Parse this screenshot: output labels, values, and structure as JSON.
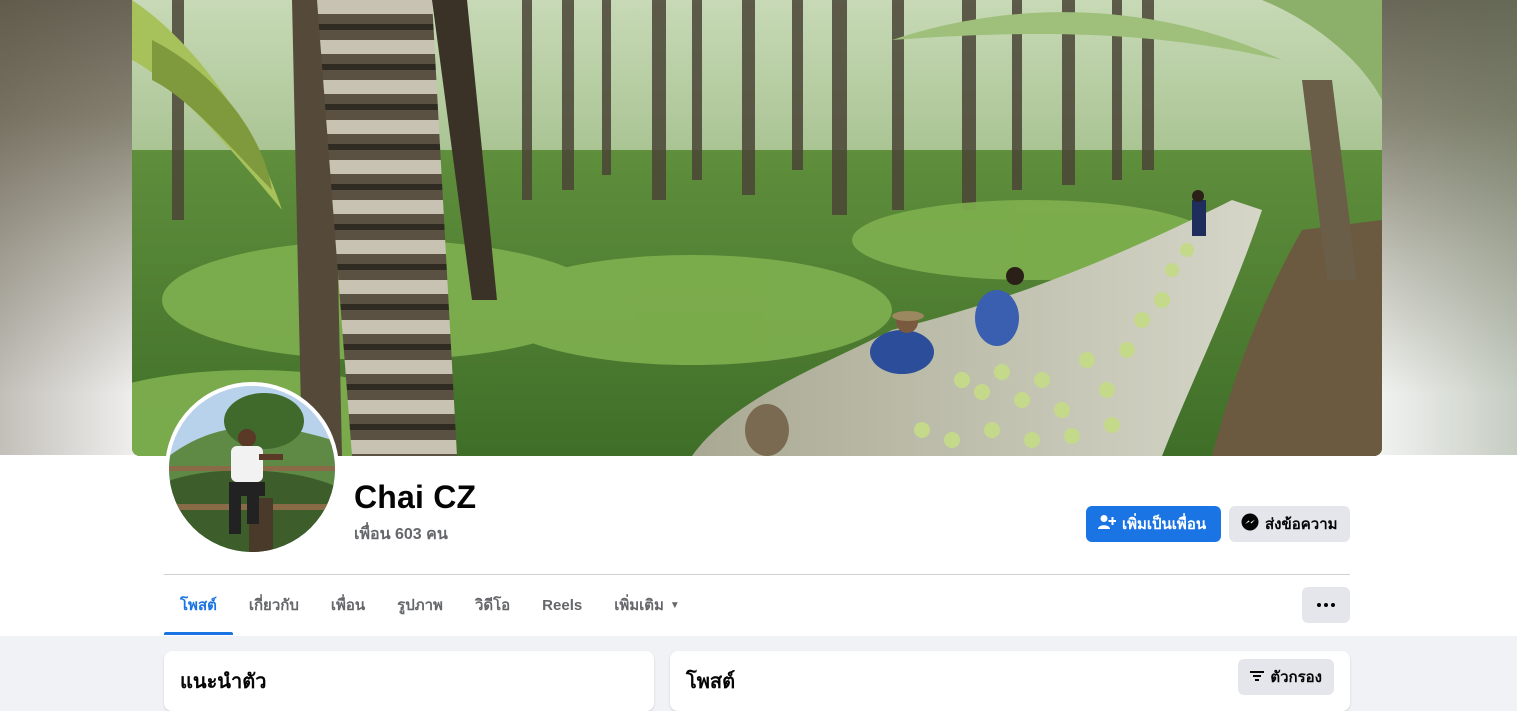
{
  "profile": {
    "name": "Chai CZ",
    "friends_text": "เพื่อน 603 คน"
  },
  "actions": {
    "add_friend": "เพิ่มเป็นเพื่อน",
    "message": "ส่งข้อความ"
  },
  "tabs": [
    {
      "label": "โพสต์",
      "active": true
    },
    {
      "label": "เกี่ยวกับ"
    },
    {
      "label": "เพื่อน"
    },
    {
      "label": "รูปภาพ"
    },
    {
      "label": "วิดีโอ"
    },
    {
      "label": "Reels"
    },
    {
      "label": "เพิ่มเติม"
    }
  ],
  "cards": {
    "intro_title": "แนะนำตัว",
    "posts_title": "โพสต์",
    "filter_label": "ตัวกรอง"
  },
  "icons": {
    "add_friend": "person-plus-icon",
    "message": "messenger-icon",
    "more": "more-dots-icon",
    "dropdown": "caret-down-icon",
    "filter": "filter-icon"
  },
  "colors": {
    "accent": "#1b74e4",
    "secondary_button": "#e4e6eb",
    "muted_text": "#65676b",
    "page_bg": "#f0f2f5"
  }
}
